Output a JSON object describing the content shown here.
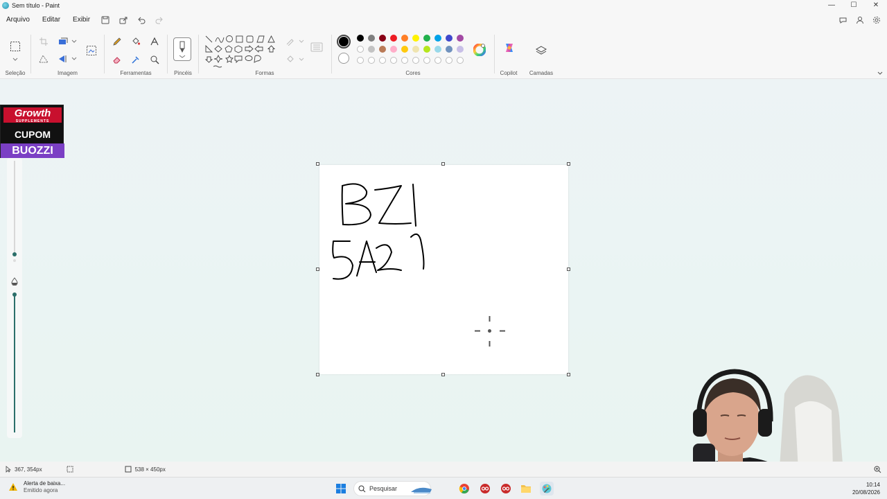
{
  "window": {
    "title": "Sem título - Paint",
    "controls": [
      "—",
      "☐",
      "✕"
    ]
  },
  "menu": {
    "items": [
      "Arquivo",
      "Editar",
      "Exibir"
    ]
  },
  "ribbon": {
    "groups": {
      "selection": "Seleção",
      "image": "Imagem",
      "tools": "Ferramentas",
      "brushes": "Pincéis",
      "shapes": "Formas",
      "colors": "Cores",
      "copilot": "Copilot",
      "layers": "Camadas"
    },
    "colors": {
      "primary": "#000000",
      "row1": [
        "#000000",
        "#7f7f7f",
        "#880015",
        "#ed1c24",
        "#ff7f27",
        "#fff200",
        "#22b14c",
        "#00a2e8",
        "#3f48cc",
        "#a349a4"
      ],
      "row2": [
        "#ffffff",
        "#c3c3c3",
        "#b97a57",
        "#ffaec9",
        "#ffc90e",
        "#efe4b0",
        "#b5e61d",
        "#99d9ea",
        "#7092be",
        "#c8bfe7"
      ]
    }
  },
  "promo": {
    "line1": "Growth",
    "line1_sub": "SUPPLEMENTS",
    "line2": "CUPOM",
    "line3": "BUOZZI"
  },
  "canvas": {
    "handwriting_line1": "BZI",
    "handwriting_line2": "5A21"
  },
  "status": {
    "cursor_pos": "367, 354px",
    "canvas_size": "538 × 450px"
  },
  "taskbar": {
    "notification_title": "Alerta de baixa...",
    "notification_sub": "Emitido agora",
    "search_placeholder": "Pesquisar",
    "time": "10:14",
    "date": "20/08/2026"
  }
}
